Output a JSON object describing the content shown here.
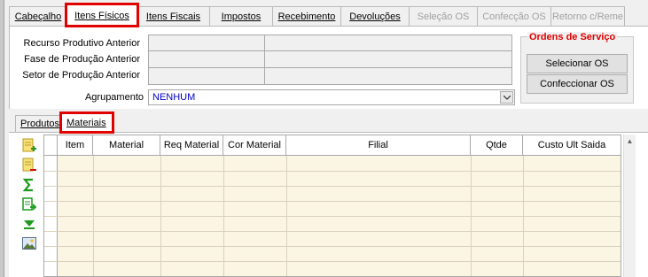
{
  "top_tabs": [
    {
      "label": "Cabeçalho",
      "state": "normal"
    },
    {
      "label": "Itens Físicos",
      "state": "active"
    },
    {
      "label": "Itens Fiscais",
      "state": "normal"
    },
    {
      "label": "Impostos",
      "state": "normal"
    },
    {
      "label": "Recebimento",
      "state": "normal"
    },
    {
      "label": "Devoluções",
      "state": "normal"
    },
    {
      "label": "Seleção OS",
      "state": "disabled"
    },
    {
      "label": "Confecção OS",
      "state": "disabled"
    },
    {
      "label": "Retorno c/Reme",
      "state": "disabled"
    }
  ],
  "fields": {
    "recurso_label": "Recurso Produtivo Anterior",
    "fase_label": "Fase de Produção Anterior",
    "setor_label": "Setor de Produção Anterior",
    "agrupamento_label": "Agrupamento",
    "agrupamento_value": "NENHUM"
  },
  "ordens_servico": {
    "title": "Ordens de Serviço",
    "selecionar_label": "Selecionar OS",
    "confeccionar_label": "Confeccionar OS"
  },
  "sub_tabs": [
    {
      "label": "Produtos",
      "state": "normal"
    },
    {
      "label": "Materiais",
      "state": "active"
    }
  ],
  "table": {
    "columns": [
      "Item",
      "Material",
      "Req Material",
      "Cor Material",
      "Filial",
      "Qtde",
      "Custo Ult Saida"
    ],
    "rows": []
  },
  "toolbar_icons": [
    "add-row-icon",
    "delete-row-icon",
    "sum-icon",
    "export-icon",
    "move-down-icon",
    "image-icon"
  ],
  "colors": {
    "highlight": "#e00000",
    "grid_bg": "#fbf5e4",
    "value_text": "#0000c8"
  }
}
